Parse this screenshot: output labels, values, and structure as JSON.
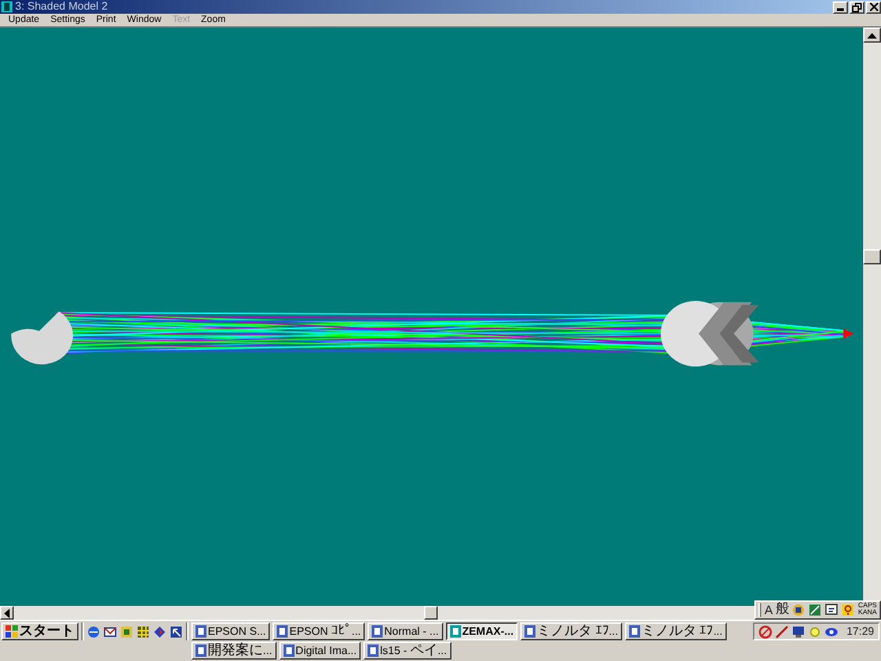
{
  "window": {
    "title": "3: Shaded Model 2"
  },
  "menu": [
    {
      "label": "Update",
      "disabled": false
    },
    {
      "label": "Settings",
      "disabled": false
    },
    {
      "label": "Print",
      "disabled": false
    },
    {
      "label": "Window",
      "disabled": false
    },
    {
      "label": "Text",
      "disabled": true
    },
    {
      "label": "Zoom",
      "disabled": false
    }
  ],
  "ime_toolbar": {
    "input_mode": "A",
    "conversion_mode": "般",
    "caps": "CAPS",
    "kana": "KANA"
  },
  "taskbar": {
    "start": "スタート",
    "buttons": [
      {
        "label": "EPSON S...",
        "selected": false
      },
      {
        "label": "EPSON ｺﾋﾟ...",
        "selected": false
      },
      {
        "label": "Normal - ...",
        "selected": false
      },
      {
        "label": "ZEMAX-...",
        "selected": true
      },
      {
        "label": "ミノルタ ｴﾌ...",
        "selected": false
      },
      {
        "label": "ミノルタ ｴﾌ...",
        "selected": false
      },
      {
        "label": "開発案に...",
        "selected": false
      },
      {
        "label": "Digital Ima...",
        "selected": false
      },
      {
        "label": "ls15 - ペイ...",
        "selected": false
      }
    ],
    "clock": "17:29"
  }
}
